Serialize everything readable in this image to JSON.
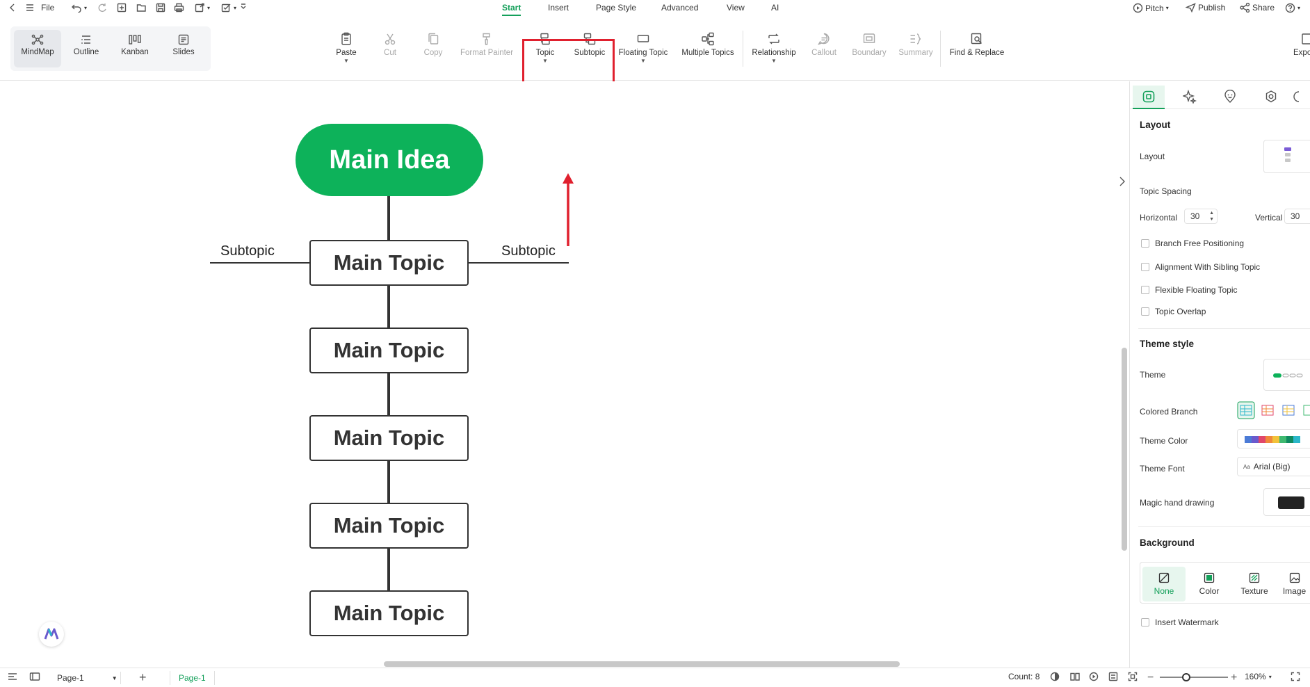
{
  "menu": {
    "file_label": "File",
    "tabs": [
      "Start",
      "Insert",
      "Page Style",
      "Advanced",
      "View",
      "AI"
    ],
    "active_tab": "Start",
    "pitch_label": "Pitch",
    "publish_label": "Publish",
    "share_label": "Share"
  },
  "view_switcher": [
    {
      "label": "MindMap",
      "icon": "mindmap-icon",
      "active": true
    },
    {
      "label": "Outline",
      "icon": "outline-icon"
    },
    {
      "label": "Kanban",
      "icon": "kanban-icon"
    },
    {
      "label": "Slides",
      "icon": "slides-icon"
    }
  ],
  "ribbon": {
    "paste": "Paste",
    "cut": "Cut",
    "copy": "Copy",
    "format_painter": "Format Painter",
    "topic": "Topic",
    "subtopic": "Subtopic",
    "floating_topic": "Floating Topic",
    "multiple_topics": "Multiple Topics",
    "relationship": "Relationship",
    "callout": "Callout",
    "boundary": "Boundary",
    "summary": "Summary",
    "find_replace": "Find & Replace",
    "export": "Expo"
  },
  "mindmap": {
    "root": "Main Idea",
    "topics": [
      "Main Topic",
      "Main Topic",
      "Main Topic",
      "Main Topic",
      "Main Topic"
    ],
    "subtopic_left": "Subtopic",
    "subtopic_right": "Subtopic",
    "root_color": "#0db25a"
  },
  "panel": {
    "layout_heading": "Layout",
    "layout_label": "Layout",
    "topic_spacing_label": "Topic Spacing",
    "horizontal_label": "Horizontal",
    "horizontal_value": "30",
    "vertical_label": "Vertical",
    "vertical_value": "30",
    "checks": [
      "Branch Free Positioning",
      "Alignment With Sibling Topic",
      "Flexible Floating Topic",
      "Topic Overlap"
    ],
    "theme_style_heading": "Theme style",
    "theme_label": "Theme",
    "colored_branch_label": "Colored Branch",
    "theme_color_label": "Theme Color",
    "theme_font_label": "Theme Font",
    "theme_font_value": "Arial (Big)",
    "magic_hand_label": "Magic hand drawing",
    "background_heading": "Background",
    "bg_options": [
      "None",
      "Color",
      "Texture",
      "Image"
    ],
    "watermark_label": "Insert Watermark",
    "theme_colors": [
      "#4b7bd6",
      "#6a5acd",
      "#e0476b",
      "#f0883a",
      "#f2c23a",
      "#3fb970",
      "#0f8a5f",
      "#2bb7c9"
    ]
  },
  "status": {
    "page_select": "Page-1",
    "page_tab": "Page-1",
    "count": "Count: 8",
    "zoom": "160%"
  },
  "accent_color": "#14a05a",
  "highlight_color": "#e0202e"
}
